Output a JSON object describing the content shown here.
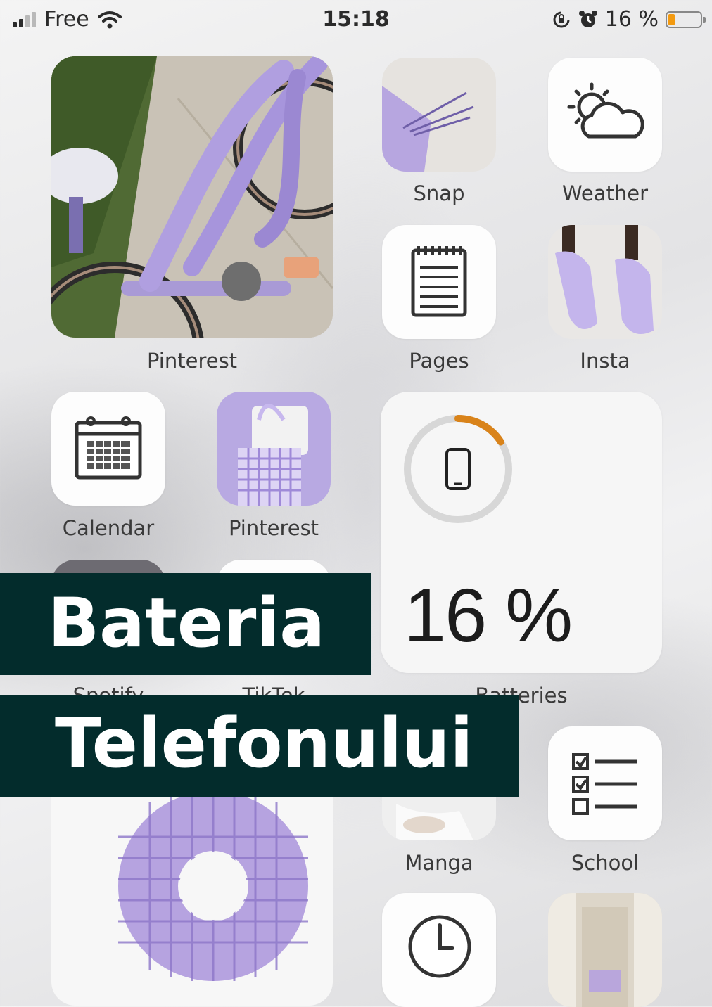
{
  "status_bar": {
    "carrier": "Free",
    "time": "15:18",
    "battery_text": "16 %"
  },
  "apps": {
    "pinterest_large": "Pinterest",
    "snap": "Snap",
    "weather": "Weather",
    "pages": "Pages",
    "insta": "Insta",
    "calendar": "Calendar",
    "pinterest_small": "Pinterest",
    "spotify": "Spotify",
    "tiktok": "TikTok",
    "batteries": "Batteries",
    "manga": "Manga",
    "school": "School"
  },
  "battery_widget": {
    "percent_text": "16 %",
    "level": 0.16,
    "ring_color": "#d9831a"
  },
  "overlay": {
    "line1": "Bateria",
    "line2": "Telefonului",
    "background": "#032c2c"
  },
  "colors": {
    "lavender": "#b7a6e0",
    "widget_bg": "#f6f6f6"
  }
}
